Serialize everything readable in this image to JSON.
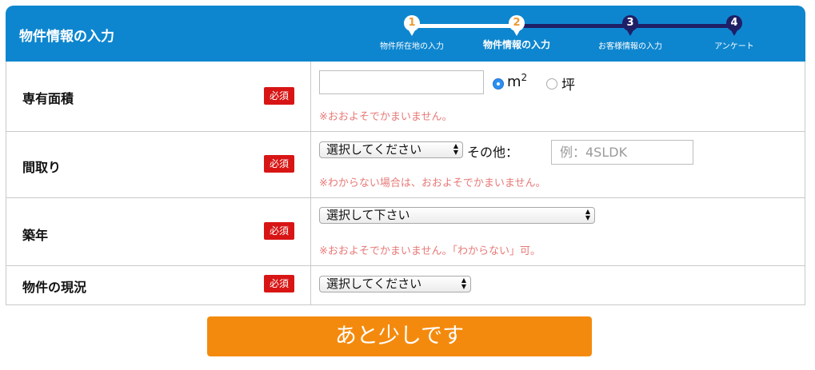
{
  "header": {
    "title": "物件情報の入力",
    "steps": [
      {
        "num": "1",
        "label": "物件所在地の入力"
      },
      {
        "num": "2",
        "label": "物件情報の入力"
      },
      {
        "num": "3",
        "label": "お客様情報の入力"
      },
      {
        "num": "4",
        "label": "アンケート"
      }
    ],
    "current_step": 2
  },
  "required_badge": "必須",
  "rows": {
    "area": {
      "label": "専有面積",
      "value": "",
      "unit_sqm": "m",
      "unit_sqm_sup": "2",
      "unit_tsubo": "坪",
      "selected_unit": "m2",
      "note": "※おおよそでかまいません。"
    },
    "layout": {
      "label": "間取り",
      "select_value": "選択してください",
      "other_label": "その他：",
      "other_placeholder": "例：4SLDK",
      "note": "※わからない場合は、おおよそでかまいません。"
    },
    "built_year": {
      "label": "築年",
      "select_value": "選択して下さい",
      "note": "※おおよそでかまいません。「わからない」可。"
    },
    "status": {
      "label": "物件の現況",
      "select_value": "選択してください"
    }
  },
  "submit_label": "あと少しです",
  "colors": {
    "header_bg": "#0e86cf",
    "step_done": "#ffffff",
    "step_todo": "#1f1f66",
    "step_number_done": "#ef9a2f",
    "required_bg": "#d81515",
    "note_text": "#e77a78",
    "submit_bg": "#f48a0d"
  }
}
